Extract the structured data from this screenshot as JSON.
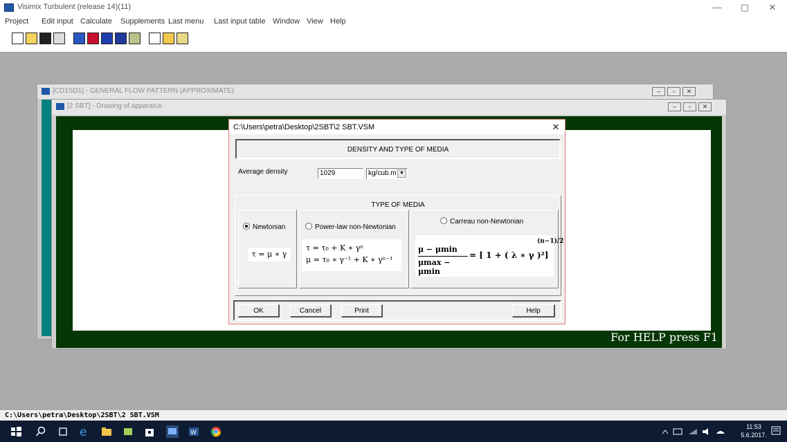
{
  "app": {
    "title": "Visimix Turbulent (release 14)(11)"
  },
  "window_controls": {
    "minimize": "—",
    "restore": "▢",
    "close": "✕"
  },
  "menu": [
    "Project",
    "Edit input",
    "Calculate",
    "Supplements",
    "Last menu",
    "Last input table",
    "Window",
    "View",
    "Help"
  ],
  "toolbar": {
    "icons": [
      "new-file-icon",
      "open-folder-icon",
      "save-icon",
      "print-icon",
      "vessel-icon",
      "baffle-icon",
      "impeller-icon",
      "shaft-icon",
      "table-icon",
      "calc-icon",
      "export-icon",
      "report-icon"
    ]
  },
  "mdi_windows": {
    "back": {
      "title": "[CD1SD1] - GENERAL FLOW PATTERN (APPROXIMATE)"
    },
    "front": {
      "title": "[2 SBT] - Drawing of apparatus",
      "help_hint": "For HELP press F1"
    },
    "button_glyphs": [
      "‒",
      "▫",
      "✕"
    ]
  },
  "dialog": {
    "title": "C:\\Users\\petra\\Desktop\\2SBT\\2 SBT.VSM",
    "close": "✕",
    "header": "DENSITY AND TYPE OF MEDIA",
    "density_label": "Average density",
    "density_value": "1029",
    "density_unit": "kg/cub.m",
    "media_title": "TYPE OF MEDIA",
    "options": [
      {
        "label": "Newtonian",
        "selected": true
      },
      {
        "label": "Power-law non-Newtonian",
        "selected": false
      },
      {
        "label": "Carreau non-Newtonian",
        "selected": false
      }
    ],
    "formulas": {
      "newtonian": "τ = μ ∗ γ",
      "power_law_1": "τ = τ₀ + K ∗ γⁿ",
      "power_law_2": "μ = τ₀ ∗ γ⁻¹ + K ∗ γⁿ⁻¹",
      "carreau_num": "μ − μmin",
      "carreau_den": "μmax − μmin",
      "carreau_rhs": "= [ 1 + ( λ ∗ γ )²]",
      "carreau_exp": "(n−1)/2"
    },
    "buttons": {
      "ok": "OK",
      "cancel": "Cancel",
      "print": "Print",
      "help": "Help"
    }
  },
  "status": {
    "path": "C:\\Users\\petra\\Desktop\\2SBT\\2 SBT.VSM"
  },
  "taskbar": {
    "clock_time": "11:53",
    "clock_date": "5.6.2017."
  }
}
